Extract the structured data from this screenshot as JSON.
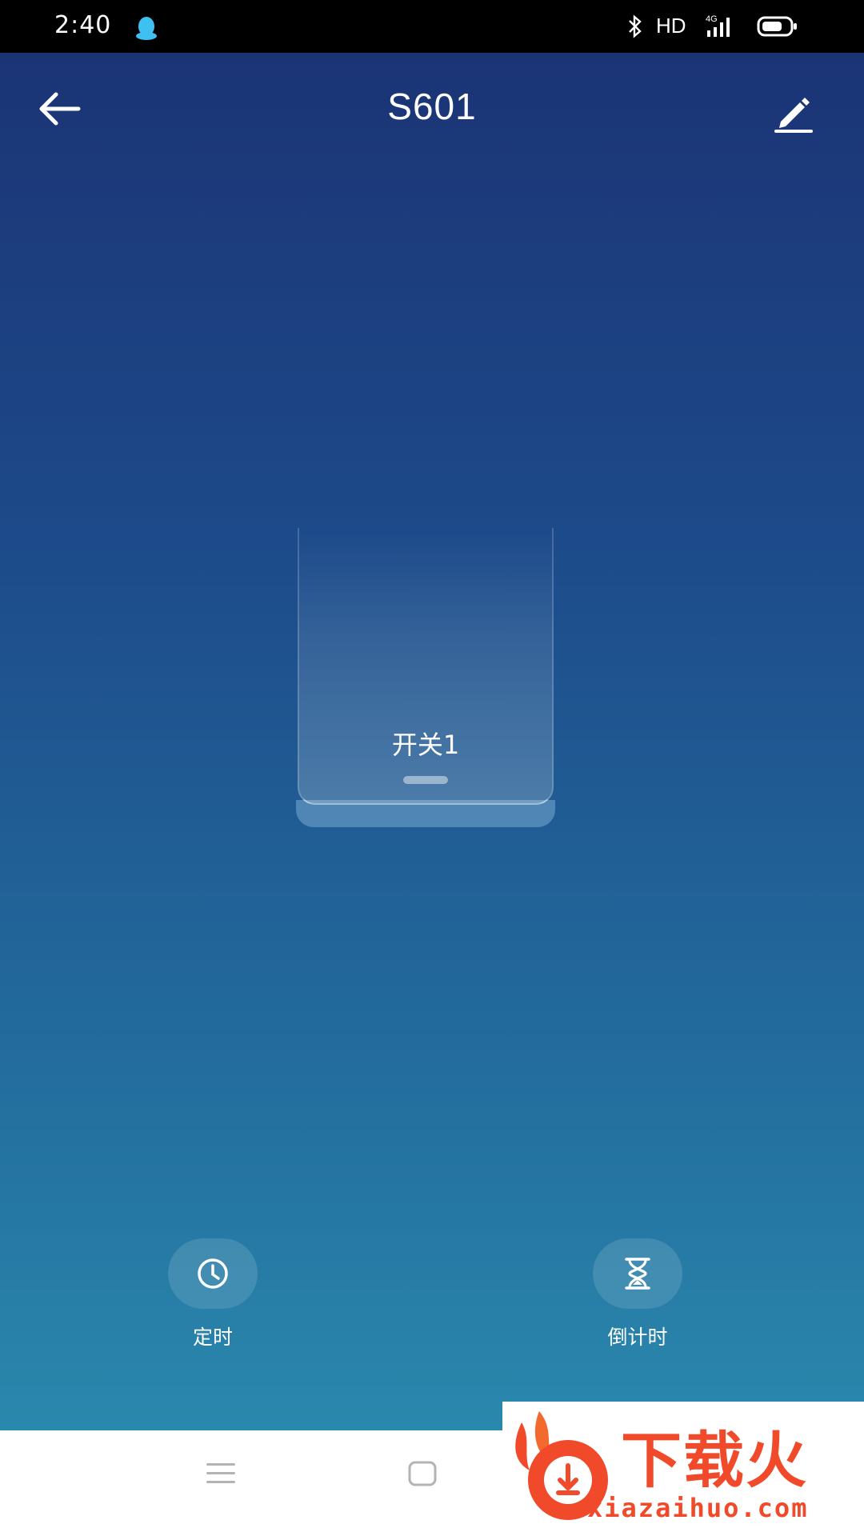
{
  "status_bar": {
    "time": "2:40",
    "network_label": "HD",
    "signal_label": "4G",
    "icons": [
      "qq-icon",
      "bluetooth-icon",
      "signal-icon",
      "battery-icon"
    ]
  },
  "header": {
    "title": "S601",
    "back_icon": "arrow-left-icon",
    "edit_icon": "pencil-icon"
  },
  "switch": {
    "label": "开关1"
  },
  "actions": {
    "timer": {
      "label": "定时",
      "icon": "clock-icon"
    },
    "countdown": {
      "label": "倒计时",
      "icon": "hourglass-icon"
    }
  },
  "nav_bar": {
    "icons": [
      "menu-icon",
      "home-square-icon"
    ]
  },
  "watermark": {
    "text": "下载火",
    "url": "xiazaihuo.com",
    "icon": "download-logo-icon"
  },
  "colors": {
    "gradient_top": "#1b3475",
    "gradient_bottom": "#2a88ad",
    "watermark_accent": "#f04a2a"
  }
}
